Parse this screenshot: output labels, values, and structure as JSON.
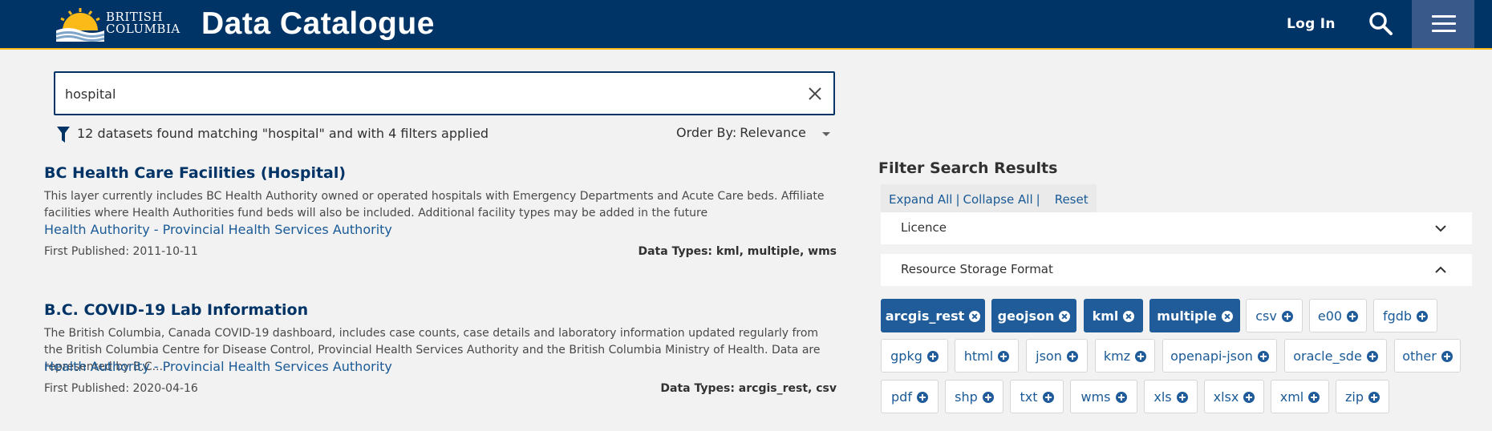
{
  "header": {
    "logo_line1": "BRITISH",
    "logo_line2": "COLUMBIA",
    "title": "Data Catalogue",
    "login_label": "Log In",
    "search_icon": "search-icon",
    "menu_icon": "hamburger-menu-icon"
  },
  "search": {
    "value": "hospital",
    "clear_icon": "close-icon"
  },
  "results": {
    "summary": "12 datasets found matching \"hospital\" and with 4 filters applied",
    "order_by_label": "Order By:",
    "order_by_value": "Relevance"
  },
  "datasets": [
    {
      "title": "BC Health Care Facilities (Hospital)",
      "description": "This layer currently includes BC Health Authority owned or operated hospitals with Emergency Departments and Acute Care beds. Affiliate facilities where Health Authorities fund beds will also be included. Additional facility types may be added in the future",
      "organization": "Health Authority - Provincial Health Services Authority",
      "published": "First Published: 2011-10-11",
      "data_types": "Data Types: kml, multiple, wms"
    },
    {
      "title": "B.C. COVID-19 Lab Information",
      "description": "The British Columbia, Canada COVID-19 dashboard, includes case counts, case details and laboratory information updated regularly from the British Columbia Centre for Disease Control, Provincial Health Services Authority and the British Columbia Ministry of Health. Data are represented by B.C....",
      "organization": "Health Authority - Provincial Health Services Authority",
      "published": "First Published: 2020-04-16",
      "data_types": "Data Types: arcgis_rest, csv"
    }
  ],
  "filters": {
    "heading": "Filter Search Results",
    "expand_all": "Expand All",
    "collapse_all": "Collapse All",
    "separator": "|",
    "reset": "Reset",
    "licence_label": "Licence",
    "format_label": "Resource Storage Format",
    "colors": {
      "active": "#1f5c99",
      "header": "#003366",
      "accent": "#fcba19"
    },
    "formats": [
      {
        "label": "arcgis_rest",
        "active": true
      },
      {
        "label": "geojson",
        "active": true
      },
      {
        "label": "kml",
        "active": true
      },
      {
        "label": "multiple",
        "active": true
      },
      {
        "label": "csv",
        "active": false
      },
      {
        "label": "e00",
        "active": false
      },
      {
        "label": "fgdb",
        "active": false
      },
      {
        "label": "gpkg",
        "active": false
      },
      {
        "label": "html",
        "active": false
      },
      {
        "label": "json",
        "active": false
      },
      {
        "label": "kmz",
        "active": false
      },
      {
        "label": "openapi-json",
        "active": false
      },
      {
        "label": "oracle_sde",
        "active": false
      },
      {
        "label": "other",
        "active": false
      },
      {
        "label": "pdf",
        "active": false
      },
      {
        "label": "shp",
        "active": false
      },
      {
        "label": "txt",
        "active": false
      },
      {
        "label": "wms",
        "active": false
      },
      {
        "label": "xls",
        "active": false
      },
      {
        "label": "xlsx",
        "active": false
      },
      {
        "label": "xml",
        "active": false
      },
      {
        "label": "zip",
        "active": false
      }
    ]
  }
}
